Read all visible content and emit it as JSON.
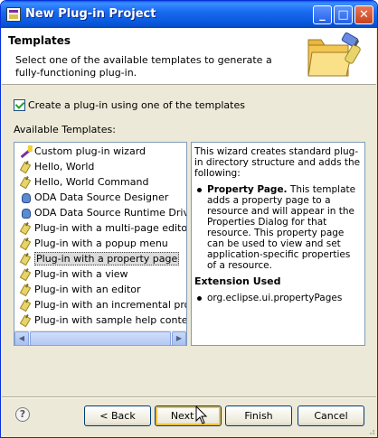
{
  "window": {
    "title": "New Plug-in Project",
    "controls": {
      "minimize": "_",
      "maximize": "□",
      "close": "✕"
    }
  },
  "banner": {
    "title": "Templates",
    "description": "Select one of the available templates to generate a fully-functioning plug-in."
  },
  "checkbox": {
    "label": "Create a plug-in using one of the templates",
    "checked": true
  },
  "available_label": "Available Templates:",
  "templates": [
    {
      "label": "Custom plug-in wizard",
      "icon": "wizard-icon"
    },
    {
      "label": "Hello, World",
      "icon": "plugin-icon"
    },
    {
      "label": "Hello, World Command",
      "icon": "plugin-icon"
    },
    {
      "label": "ODA Data Source Designer",
      "icon": "data-source-icon"
    },
    {
      "label": "ODA Data Source Runtime Driver",
      "icon": "data-source-icon"
    },
    {
      "label": "Plug-in with a multi-page editor",
      "icon": "plugin-icon"
    },
    {
      "label": "Plug-in with a popup menu",
      "icon": "plugin-icon"
    },
    {
      "label": "Plug-in with a property page",
      "icon": "plugin-icon",
      "selected": true
    },
    {
      "label": "Plug-in with a view",
      "icon": "plugin-icon"
    },
    {
      "label": "Plug-in with an editor",
      "icon": "plugin-icon"
    },
    {
      "label": "Plug-in with an incremental project",
      "icon": "plugin-icon"
    },
    {
      "label": "Plug-in with sample help content",
      "icon": "plugin-icon"
    }
  ],
  "description": {
    "intro": "This wizard creates standard plug-in directory structure and adds the following:",
    "bullet_title": "Property Page.",
    "bullet_text": " This template adds a property page to a resource and will appear in the Properties Dialog for that resource. This property page can be used to view and set application-specific properties of a resource.",
    "extension_heading": "Extension Used",
    "extension_point": "org.eclipse.ui.propertyPages"
  },
  "buttons": {
    "back": "< Back",
    "next": "Next >",
    "finish": "Finish",
    "cancel": "Cancel",
    "help": "?"
  },
  "colors": {
    "titlebar": "#0554d8",
    "dialog_bg": "#ece9d8",
    "list_border": "#7f9db9",
    "selection": "#dcdcdc"
  }
}
